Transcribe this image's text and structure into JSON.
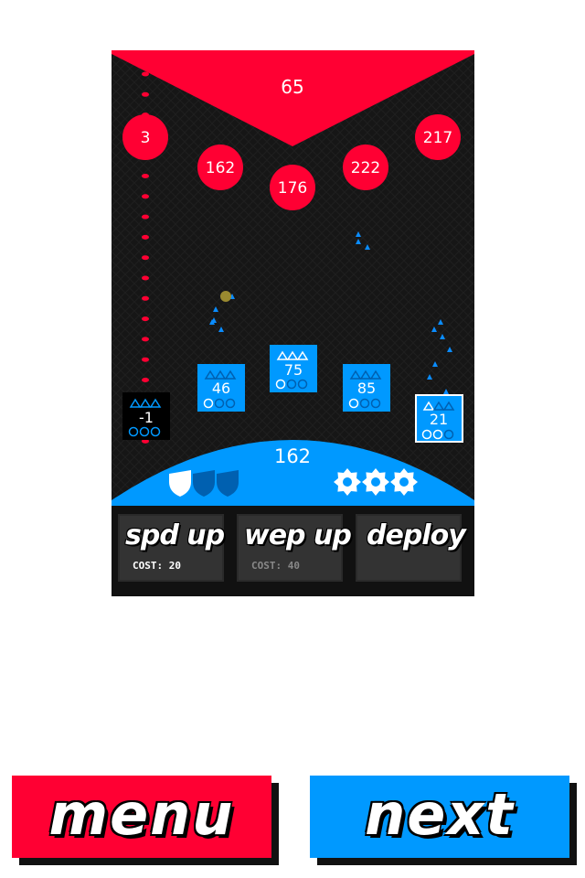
{
  "enemy": {
    "color": "#ff0033",
    "base_hp": "65",
    "units": [
      "3",
      "162",
      "176",
      "222",
      "217"
    ],
    "track_dots": 19
  },
  "player": {
    "color": "#0099ff",
    "base_hp": "162",
    "shields": 3,
    "shields_active": 1,
    "gears": 3,
    "units": [
      "-1",
      "46",
      "75",
      "85",
      "21"
    ]
  },
  "actions": {
    "spd_up": {
      "label": "spd up",
      "cost": "COST: 20"
    },
    "wep_up": {
      "label": "wep up",
      "cost": "COST: 40"
    },
    "deploy": {
      "label": "deploy"
    }
  },
  "footer": {
    "menu_label": "menu",
    "next_label": "next",
    "menu_color": "#ff0033",
    "next_color": "#0099ff"
  }
}
